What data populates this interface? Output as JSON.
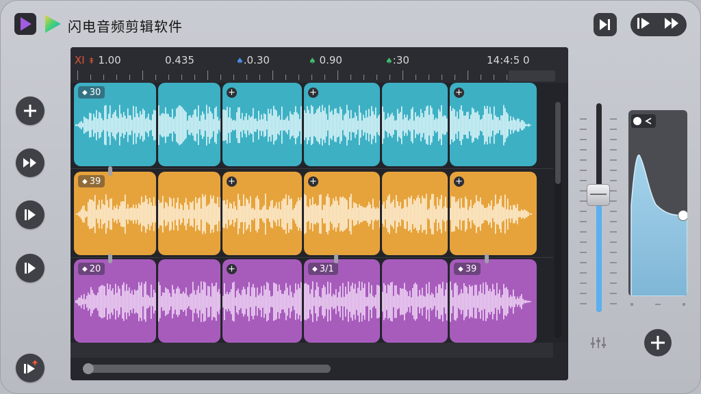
{
  "app": {
    "title": "闪电音频剪辑软件"
  },
  "ruler": {
    "labels": [
      {
        "text": "1.00",
        "prefix": "XI"
      },
      {
        "text": "0.435"
      },
      {
        "text": ".0.30"
      },
      {
        "text": "0.90"
      },
      {
        "text": ":30"
      },
      {
        "text": "14:4:5 0"
      }
    ]
  },
  "tracks": [
    {
      "color": "#3db0c4",
      "wave_color": "#dff6fa",
      "clips": [
        {
          "badge": "30",
          "icon": "diamond"
        },
        {
          "badge": "",
          "icon": ""
        },
        {
          "badge": "",
          "icon": "plus"
        },
        {
          "badge": "",
          "icon": "plus"
        },
        {
          "badge": "",
          "icon": ""
        },
        {
          "badge": "",
          "icon": "plus"
        }
      ]
    },
    {
      "color": "#e6a33c",
      "wave_color": "#fdf0d8",
      "clips": [
        {
          "badge": "39",
          "icon": "diamond"
        },
        {
          "badge": "",
          "icon": ""
        },
        {
          "badge": "",
          "icon": "plus"
        },
        {
          "badge": "",
          "icon": "plus"
        },
        {
          "badge": "",
          "icon": ""
        },
        {
          "badge": "",
          "icon": "plus"
        }
      ]
    },
    {
      "color": "#a75cbc",
      "wave_color": "#f0d6f6",
      "clips": [
        {
          "badge": "20",
          "icon": "diamond"
        },
        {
          "badge": "",
          "icon": ""
        },
        {
          "badge": "",
          "icon": "plus"
        },
        {
          "badge": "3/1",
          "icon": "diamond"
        },
        {
          "badge": "",
          "icon": ""
        },
        {
          "badge": "39",
          "icon": "diamond"
        }
      ]
    }
  ],
  "volume": {
    "level": 0.55
  },
  "icons": {
    "app_logo_1": "play-logo-icon",
    "app_logo_2": "play-logo-gradient-icon",
    "side": [
      "plus-icon",
      "fast-forward-icon",
      "play-pause-icon",
      "play-pause-icon",
      "play-pause-record-icon"
    ],
    "top_right": [
      "skip-to-end-icon",
      "play-pause-icon",
      "fast-forward-icon"
    ],
    "mixer": "mixer-icon",
    "add": "plus-icon"
  },
  "colors": {
    "accent_blue": "#5ab0f0",
    "panel_bg": "#23242a"
  }
}
